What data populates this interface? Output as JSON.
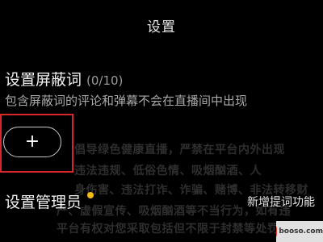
{
  "header": {
    "title": "设置"
  },
  "block_words": {
    "title": "设置屏蔽词",
    "count": "(0/10)",
    "description": "包含屏蔽词的评论和弹幕不会在直播间中出现",
    "add_button_icon": "plus-icon",
    "add_button_label": "+"
  },
  "background_notice": {
    "lines": [
      "倡导绿色健康直播，严禁在平台内外出现",
      "违法违规、低俗色情、吸烟酗酒、人",
      "身伤害、违法打诈、诈骗、赌博、非法转移财",
      "产、虚假宣传、吸烟酗酒等不当行为，如有违",
      "平台有权对您采取包括但不限于封禁等处罚"
    ]
  },
  "manager": {
    "title": "设置管理员",
    "badge_color": "#f5b914",
    "new_feature_text": "新增提词功能"
  },
  "colors": {
    "highlight_border": "#d9262b",
    "background": "#000000"
  },
  "watermark": {
    "text": "booso.com"
  }
}
